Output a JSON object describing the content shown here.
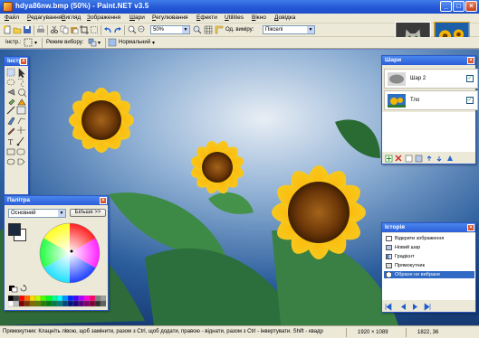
{
  "window": {
    "title": "hdya86nw.bmp (50%) - Paint.NET v3.5",
    "minimize_glyph": "_",
    "maximize_glyph": "□",
    "close_glyph": "×"
  },
  "menu": [
    "Файл",
    "Редагування",
    "Вигляд",
    "Зображення",
    "Шари",
    "Регулювання",
    "Ефекти",
    "Utilities",
    "Вікно",
    "Довідка"
  ],
  "toolbar": {
    "zoom_value": "50%",
    "sampling_label": "Од. виміру:",
    "units_value": "Пікселі",
    "tool_label": "Інстр.:",
    "selection_mode_label": "Режим вибору:",
    "blend_mode_value": "Нормальний"
  },
  "panels": {
    "tools": {
      "title": "Інстр"
    },
    "layers": {
      "title": "Шари",
      "items": [
        {
          "label": "Шар 2",
          "checked": "✓"
        },
        {
          "label": "Тло",
          "checked": "✓"
        }
      ]
    },
    "palette": {
      "title": "Палітра",
      "mode_value": "Основний",
      "more_button": "Більше >>"
    },
    "history": {
      "title": "Історія",
      "items": [
        {
          "label": "Відкрити зображення"
        },
        {
          "label": "Новий шар"
        },
        {
          "label": "Градієнт"
        },
        {
          "label": "Прямокутник"
        },
        {
          "label": "Обране не вибране"
        }
      ]
    }
  },
  "statusbar": {
    "hint": "Прямокутник: Клацніть лівою, щоб замінити, разом з Ctrl, щоб додати, правою - віднати, разом з Ctrl - інвертувати. Shift - квадр",
    "image_size": "1920 × 1089",
    "cursor_pos": "1822, 36"
  },
  "colors": {
    "titlebar": "#2458d6",
    "panel_bg": "#ece9d8",
    "selection": "#316ac5",
    "primary_color": "#1b2a3e",
    "secondary_color": "#ffffff"
  }
}
